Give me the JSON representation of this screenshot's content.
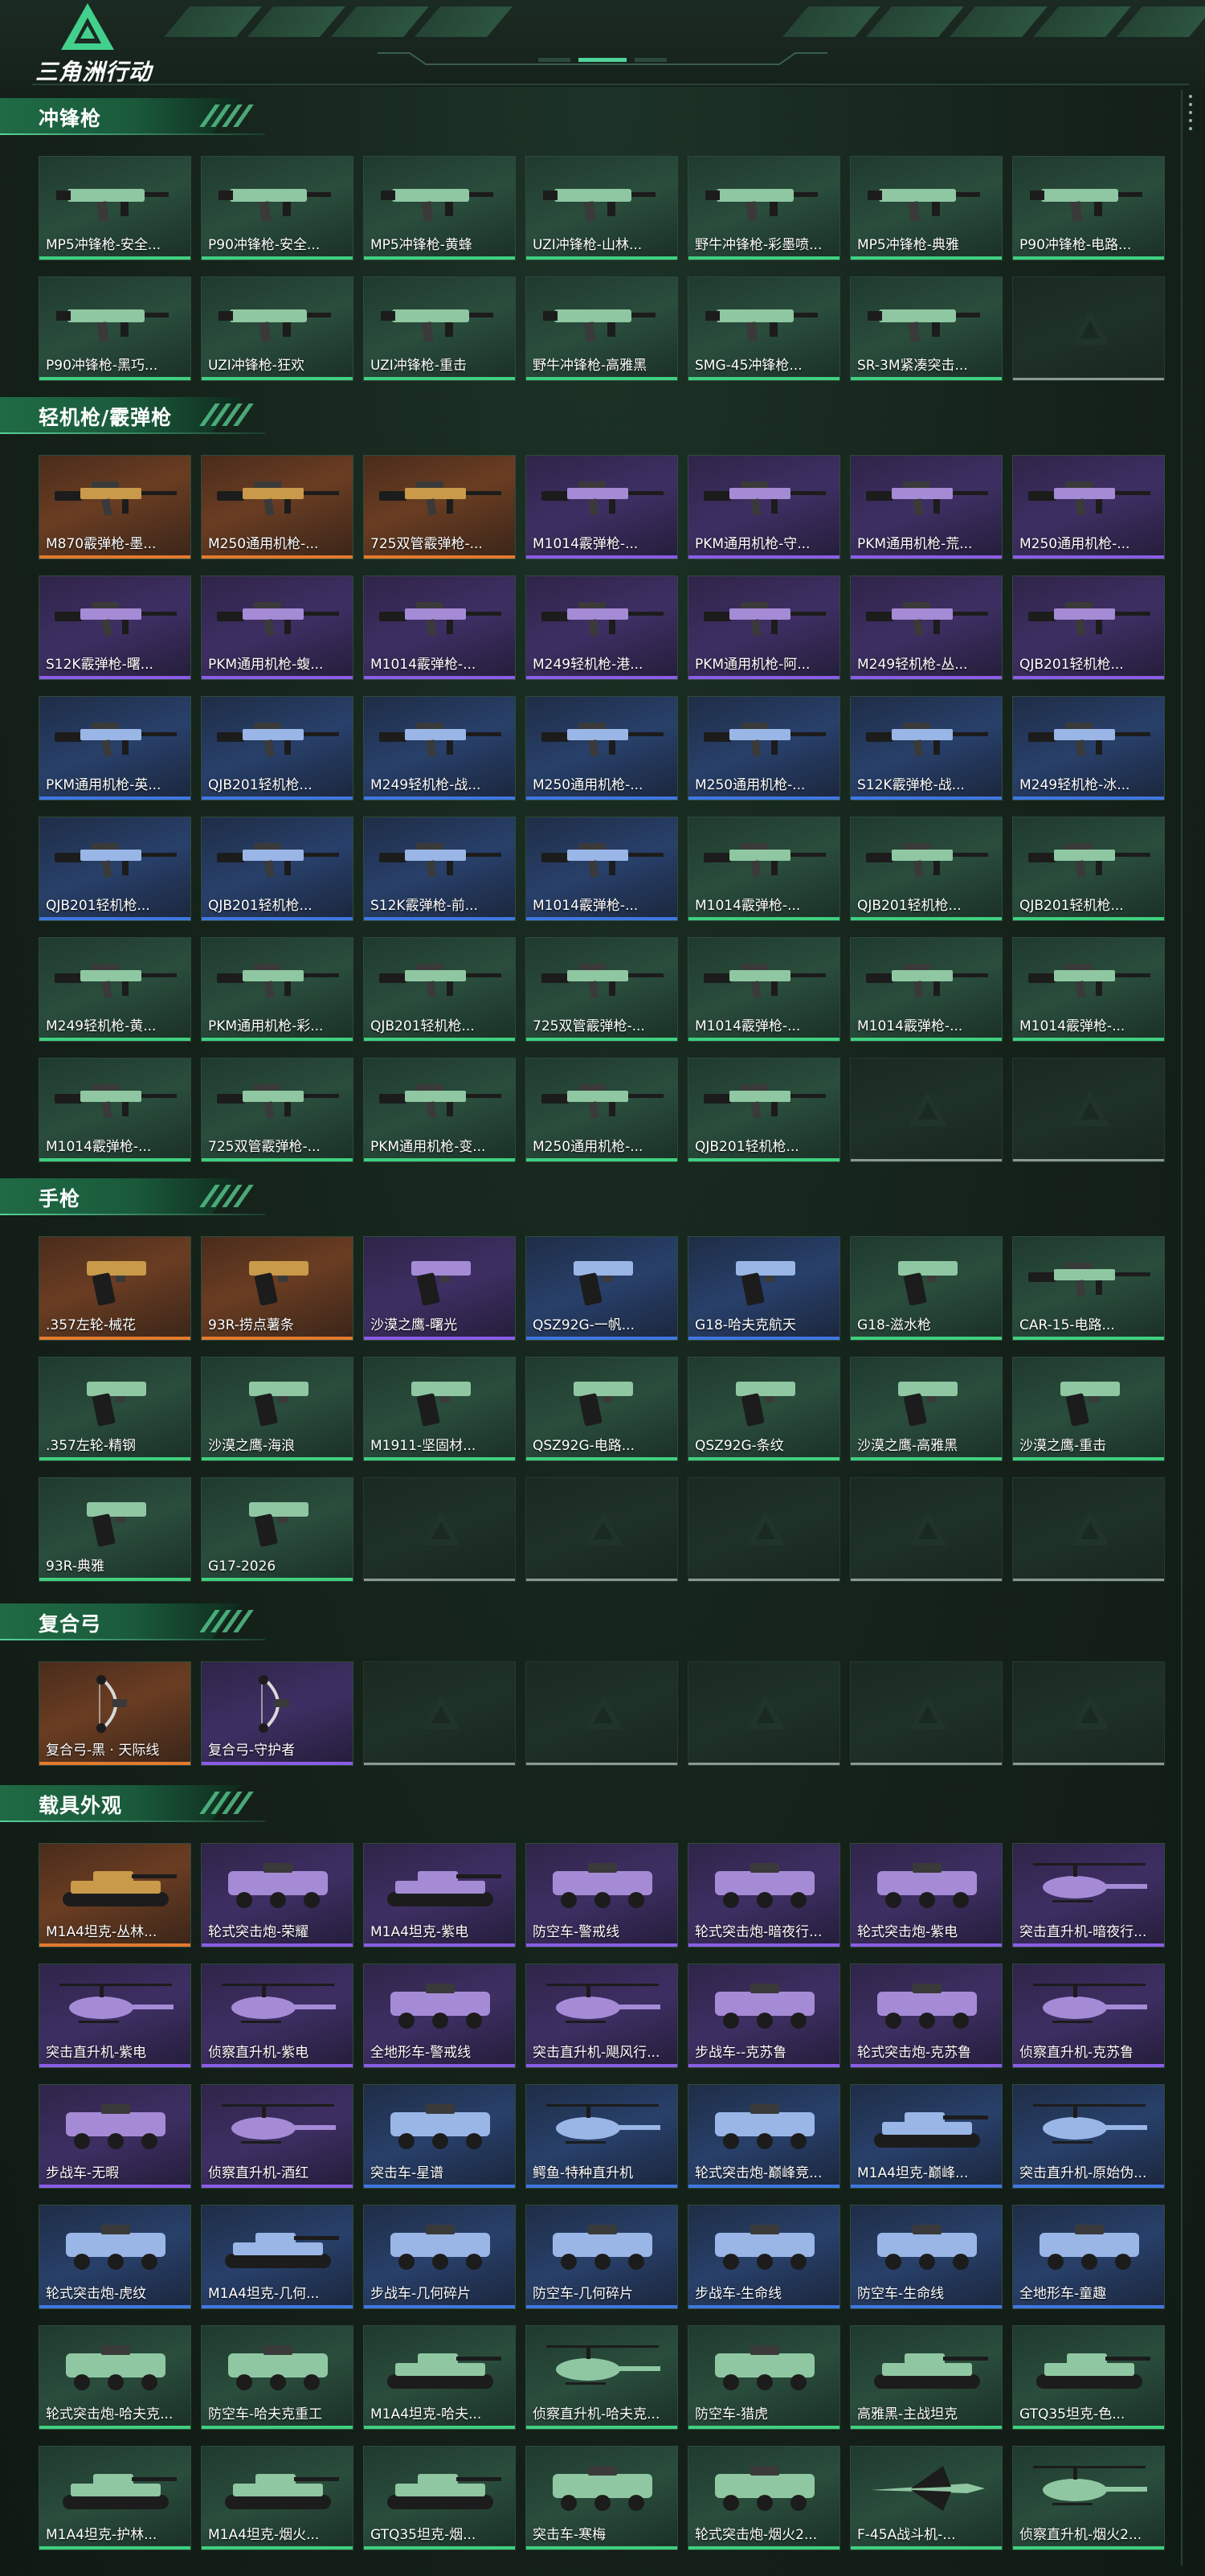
{
  "brand": {
    "logo_text": "三角洲行动"
  },
  "sections": [
    {
      "title": "冲锋枪",
      "items": [
        {
          "name": "MP5冲锋枪-安全...",
          "rarity": "green",
          "kind": "smg"
        },
        {
          "name": "P90冲锋枪-安全...",
          "rarity": "green",
          "kind": "smg"
        },
        {
          "name": "MP5冲锋枪-黄蜂",
          "rarity": "green",
          "kind": "smg"
        },
        {
          "name": "UZI冲锋枪-山林...",
          "rarity": "green",
          "kind": "smg"
        },
        {
          "name": "野牛冲锋枪-彩墨喷...",
          "rarity": "green",
          "kind": "smg"
        },
        {
          "name": "MP5冲锋枪-典雅",
          "rarity": "green",
          "kind": "smg"
        },
        {
          "name": "P90冲锋枪-电路...",
          "rarity": "green",
          "kind": "smg"
        },
        {
          "name": "P90冲锋枪-黑巧...",
          "rarity": "green",
          "kind": "smg"
        },
        {
          "name": "UZI冲锋枪-狂欢",
          "rarity": "green",
          "kind": "smg"
        },
        {
          "name": "UZI冲锋枪-重击",
          "rarity": "green",
          "kind": "smg"
        },
        {
          "name": "野牛冲锋枪-高雅黑",
          "rarity": "green",
          "kind": "smg"
        },
        {
          "name": "SMG-45冲锋枪...",
          "rarity": "green",
          "kind": "smg"
        },
        {
          "name": "SR-3M紧凑突击...",
          "rarity": "green",
          "kind": "smg"
        },
        {
          "name": "",
          "rarity": "empty",
          "kind": "empty"
        }
      ]
    },
    {
      "title": "轻机枪/霰弹枪",
      "items": [
        {
          "name": "M870霰弹枪-墨...",
          "rarity": "gold",
          "kind": "rifle"
        },
        {
          "name": "M250通用机枪-...",
          "rarity": "gold",
          "kind": "rifle"
        },
        {
          "name": "725双管霰弹枪-...",
          "rarity": "gold",
          "kind": "rifle"
        },
        {
          "name": "M1014霰弹枪-...",
          "rarity": "purple",
          "kind": "rifle"
        },
        {
          "name": "PKM通用机枪-守...",
          "rarity": "purple",
          "kind": "rifle"
        },
        {
          "name": "PKM通用机枪-荒...",
          "rarity": "purple",
          "kind": "rifle"
        },
        {
          "name": "M250通用机枪-...",
          "rarity": "purple",
          "kind": "rifle"
        },
        {
          "name": "S12K霰弹枪-曙...",
          "rarity": "purple",
          "kind": "rifle"
        },
        {
          "name": "PKM通用机枪-蝮...",
          "rarity": "purple",
          "kind": "rifle"
        },
        {
          "name": "M1014霰弹枪-...",
          "rarity": "purple",
          "kind": "rifle"
        },
        {
          "name": "M249轻机枪-港...",
          "rarity": "purple",
          "kind": "rifle"
        },
        {
          "name": "PKM通用机枪-阿...",
          "rarity": "purple",
          "kind": "rifle"
        },
        {
          "name": "M249轻机枪-丛...",
          "rarity": "purple",
          "kind": "rifle"
        },
        {
          "name": "QJB201轻机枪...",
          "rarity": "purple",
          "kind": "rifle"
        },
        {
          "name": "PKM通用机枪-英...",
          "rarity": "blue",
          "kind": "rifle"
        },
        {
          "name": "QJB201轻机枪...",
          "rarity": "blue",
          "kind": "rifle"
        },
        {
          "name": "M249轻机枪-战...",
          "rarity": "blue",
          "kind": "rifle"
        },
        {
          "name": "M250通用机枪-...",
          "rarity": "blue",
          "kind": "rifle"
        },
        {
          "name": "M250通用机枪-...",
          "rarity": "blue",
          "kind": "rifle"
        },
        {
          "name": "S12K霰弹枪-战...",
          "rarity": "blue",
          "kind": "rifle"
        },
        {
          "name": "M249轻机枪-冰...",
          "rarity": "blue",
          "kind": "rifle"
        },
        {
          "name": "QJB201轻机枪...",
          "rarity": "blue",
          "kind": "rifle"
        },
        {
          "name": "QJB201轻机枪...",
          "rarity": "blue",
          "kind": "rifle"
        },
        {
          "name": "S12K霰弹枪-前...",
          "rarity": "blue",
          "kind": "rifle"
        },
        {
          "name": "M1014霰弹枪-...",
          "rarity": "blue",
          "kind": "rifle"
        },
        {
          "name": "M1014霰弹枪-...",
          "rarity": "green",
          "kind": "rifle"
        },
        {
          "name": "QJB201轻机枪...",
          "rarity": "green",
          "kind": "rifle"
        },
        {
          "name": "QJB201轻机枪...",
          "rarity": "green",
          "kind": "rifle"
        },
        {
          "name": "M249轻机枪-黄...",
          "rarity": "green",
          "kind": "rifle"
        },
        {
          "name": "PKM通用机枪-彩...",
          "rarity": "green",
          "kind": "rifle"
        },
        {
          "name": "QJB201轻机枪...",
          "rarity": "green",
          "kind": "rifle"
        },
        {
          "name": "725双管霰弹枪-...",
          "rarity": "green",
          "kind": "rifle"
        },
        {
          "name": "M1014霰弹枪-...",
          "rarity": "green",
          "kind": "rifle"
        },
        {
          "name": "M1014霰弹枪-...",
          "rarity": "green",
          "kind": "rifle"
        },
        {
          "name": "M1014霰弹枪-...",
          "rarity": "green",
          "kind": "rifle"
        },
        {
          "name": "M1014霰弹枪-...",
          "rarity": "green",
          "kind": "rifle"
        },
        {
          "name": "725双管霰弹枪-...",
          "rarity": "green",
          "kind": "rifle"
        },
        {
          "name": "PKM通用机枪-变...",
          "rarity": "green",
          "kind": "rifle"
        },
        {
          "name": "M250通用机枪-...",
          "rarity": "green",
          "kind": "rifle"
        },
        {
          "name": "QJB201轻机枪...",
          "rarity": "green",
          "kind": "rifle"
        },
        {
          "name": "",
          "rarity": "empty",
          "kind": "empty"
        },
        {
          "name": "",
          "rarity": "empty",
          "kind": "empty"
        }
      ]
    },
    {
      "title": "手枪",
      "items": [
        {
          "name": ".357左轮-械花",
          "rarity": "gold",
          "kind": "pistol"
        },
        {
          "name": "93R-捞点薯条",
          "rarity": "gold",
          "kind": "pistol"
        },
        {
          "name": "沙漠之鹰-曙光",
          "rarity": "purple",
          "kind": "pistol"
        },
        {
          "name": "QSZ92G-一帆...",
          "rarity": "blue",
          "kind": "pistol"
        },
        {
          "name": "G18-哈夫克航天",
          "rarity": "blue",
          "kind": "pistol"
        },
        {
          "name": "G18-滋水枪",
          "rarity": "green",
          "kind": "pistol"
        },
        {
          "name": "CAR-15-电路...",
          "rarity": "green",
          "kind": "rifle"
        },
        {
          "name": ".357左轮-精钢",
          "rarity": "green",
          "kind": "pistol"
        },
        {
          "name": "沙漠之鹰-海浪",
          "rarity": "green",
          "kind": "pistol"
        },
        {
          "name": "M1911-坚固材...",
          "rarity": "green",
          "kind": "pistol"
        },
        {
          "name": "QSZ92G-电路...",
          "rarity": "green",
          "kind": "pistol"
        },
        {
          "name": "QSZ92G-条纹",
          "rarity": "green",
          "kind": "pistol"
        },
        {
          "name": "沙漠之鹰-高雅黑",
          "rarity": "green",
          "kind": "pistol"
        },
        {
          "name": "沙漠之鹰-重击",
          "rarity": "green",
          "kind": "pistol"
        },
        {
          "name": "93R-典雅",
          "rarity": "green",
          "kind": "pistol"
        },
        {
          "name": "G17-2026",
          "rarity": "green",
          "kind": "pistol"
        },
        {
          "name": "",
          "rarity": "empty",
          "kind": "empty"
        },
        {
          "name": "",
          "rarity": "empty",
          "kind": "empty"
        },
        {
          "name": "",
          "rarity": "empty",
          "kind": "empty"
        },
        {
          "name": "",
          "rarity": "empty",
          "kind": "empty"
        },
        {
          "name": "",
          "rarity": "empty",
          "kind": "empty"
        }
      ]
    },
    {
      "title": "复合弓",
      "items": [
        {
          "name": "复合弓-黑 · 天际线",
          "rarity": "gold",
          "kind": "bow"
        },
        {
          "name": "复合弓-守护者",
          "rarity": "purple",
          "kind": "bow"
        },
        {
          "name": "",
          "rarity": "empty",
          "kind": "empty"
        },
        {
          "name": "",
          "rarity": "empty",
          "kind": "empty"
        },
        {
          "name": "",
          "rarity": "empty",
          "kind": "empty"
        },
        {
          "name": "",
          "rarity": "empty",
          "kind": "empty"
        },
        {
          "name": "",
          "rarity": "empty",
          "kind": "empty"
        }
      ]
    },
    {
      "title": "载具外观",
      "items": [
        {
          "name": "M1A4坦克-丛林...",
          "rarity": "gold",
          "kind": "tank"
        },
        {
          "name": "轮式突击炮-荣耀",
          "rarity": "purple",
          "kind": "vehicle"
        },
        {
          "name": "M1A4坦克-紫电",
          "rarity": "purple",
          "kind": "tank"
        },
        {
          "name": "防空车-警戒线",
          "rarity": "purple",
          "kind": "vehicle"
        },
        {
          "name": "轮式突击炮-暗夜行...",
          "rarity": "purple",
          "kind": "vehicle"
        },
        {
          "name": "轮式突击炮-紫电",
          "rarity": "purple",
          "kind": "vehicle"
        },
        {
          "name": "突击直升机-暗夜行...",
          "rarity": "purple",
          "kind": "heli"
        },
        {
          "name": "突击直升机-紫电",
          "rarity": "purple",
          "kind": "heli"
        },
        {
          "name": "侦察直升机-紫电",
          "rarity": "purple",
          "kind": "heli"
        },
        {
          "name": "全地形车-警戒线",
          "rarity": "purple",
          "kind": "vehicle"
        },
        {
          "name": "突击直升机-飓风行...",
          "rarity": "purple",
          "kind": "heli"
        },
        {
          "name": "步战车--克苏鲁",
          "rarity": "purple",
          "kind": "vehicle"
        },
        {
          "name": "轮式突击炮-克苏鲁",
          "rarity": "purple",
          "kind": "vehicle"
        },
        {
          "name": "侦察直升机-克苏鲁",
          "rarity": "purple",
          "kind": "heli"
        },
        {
          "name": "步战车-无暇",
          "rarity": "purple",
          "kind": "vehicle"
        },
        {
          "name": "侦察直升机-酒红",
          "rarity": "purple",
          "kind": "heli"
        },
        {
          "name": "突击车-星谱",
          "rarity": "blue",
          "kind": "vehicle"
        },
        {
          "name": "鳄鱼-特种直升机",
          "rarity": "blue",
          "kind": "heli"
        },
        {
          "name": "轮式突击炮-巅峰竞...",
          "rarity": "blue",
          "kind": "vehicle"
        },
        {
          "name": "M1A4坦克-巅峰...",
          "rarity": "blue",
          "kind": "tank"
        },
        {
          "name": "突击直升机-原始伪...",
          "rarity": "blue",
          "kind": "heli"
        },
        {
          "name": "轮式突击炮-虎纹",
          "rarity": "blue",
          "kind": "vehicle"
        },
        {
          "name": "M1A4坦克-几何...",
          "rarity": "blue",
          "kind": "tank"
        },
        {
          "name": "步战车-几何碎片",
          "rarity": "blue",
          "kind": "vehicle"
        },
        {
          "name": "防空车-几何碎片",
          "rarity": "blue",
          "kind": "vehicle"
        },
        {
          "name": "步战车-生命线",
          "rarity": "blue",
          "kind": "vehicle"
        },
        {
          "name": "防空车-生命线",
          "rarity": "blue",
          "kind": "vehicle"
        },
        {
          "name": "全地形车-童趣",
          "rarity": "blue",
          "kind": "vehicle"
        },
        {
          "name": "轮式突击炮-哈夫克...",
          "rarity": "green",
          "kind": "vehicle"
        },
        {
          "name": "防空车-哈夫克重工",
          "rarity": "green",
          "kind": "vehicle"
        },
        {
          "name": "M1A4坦克-哈夫...",
          "rarity": "green",
          "kind": "tank"
        },
        {
          "name": "侦察直升机-哈夫克...",
          "rarity": "green",
          "kind": "heli"
        },
        {
          "name": "防空车-猎虎",
          "rarity": "green",
          "kind": "vehicle"
        },
        {
          "name": "高雅黑-主战坦克",
          "rarity": "green",
          "kind": "tank"
        },
        {
          "name": "GTQ35坦克-色...",
          "rarity": "green",
          "kind": "tank"
        },
        {
          "name": "M1A4坦克-护林...",
          "rarity": "green",
          "kind": "tank"
        },
        {
          "name": "M1A4坦克-烟火...",
          "rarity": "green",
          "kind": "tank"
        },
        {
          "name": "GTQ35坦克-烟...",
          "rarity": "green",
          "kind": "tank"
        },
        {
          "name": "突击车-寒梅",
          "rarity": "green",
          "kind": "vehicle"
        },
        {
          "name": "轮式突击炮-烟火2...",
          "rarity": "green",
          "kind": "vehicle"
        },
        {
          "name": "F-45A战斗机-...",
          "rarity": "green",
          "kind": "jet"
        },
        {
          "name": "侦察直升机-烟火2...",
          "rarity": "green",
          "kind": "heli"
        }
      ]
    }
  ]
}
